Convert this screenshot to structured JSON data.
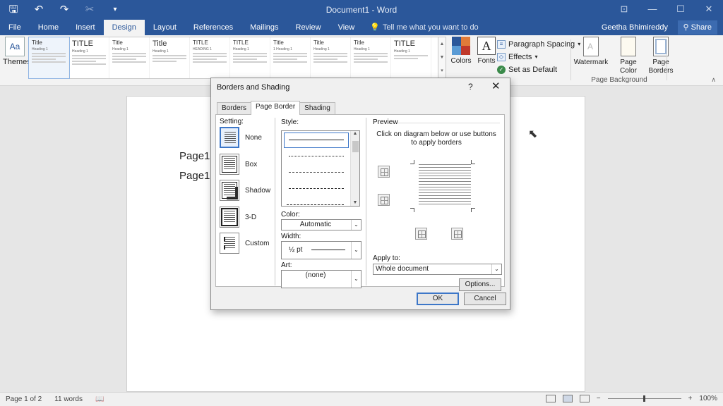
{
  "titlebar": {
    "title": "Document1 - Word",
    "qat": {
      "save": "🖫",
      "undo": "↶",
      "redo": "↷",
      "cut": "✂",
      "customize": "▾"
    },
    "window_buttons": {
      "ribbon_options": "⊡",
      "minimize": "—",
      "maximize": "☐",
      "close": "✕"
    }
  },
  "tabs": [
    "File",
    "Home",
    "Insert",
    "Design",
    "Layout",
    "References",
    "Mailings",
    "Review",
    "View"
  ],
  "active_tab": "Design",
  "tellme": {
    "icon": "💡",
    "text": "Tell me what you want to do"
  },
  "user": "Geetha Bhimireddy",
  "share": "Share",
  "ribbon": {
    "themes_label": "Themes",
    "themes_icon_text": "Aa",
    "gallery": [
      {
        "title": "Title",
        "heading": "Heading 1"
      },
      {
        "title": "TITLE",
        "heading": "Heading 1"
      },
      {
        "title": "Title",
        "heading": "Heading 1"
      },
      {
        "title": "Title",
        "heading": "Heading 1"
      },
      {
        "title": "TITLE",
        "heading": "HEADING 1"
      },
      {
        "title": "TITLE",
        "heading": "Heading 1"
      },
      {
        "title": "Title",
        "heading": "1 Heading 1"
      },
      {
        "title": "Title",
        "heading": "Heading 1"
      },
      {
        "title": "Title",
        "heading": "Heading 1"
      },
      {
        "title": "TITLE",
        "heading": "Heading 1"
      }
    ],
    "colors_label": "Colors",
    "fonts_label": "Fonts",
    "fonts_icon_text": "A",
    "paragraph_spacing": "Paragraph Spacing",
    "effects": "Effects",
    "set_as_default": "Set as Default",
    "watermark": "Watermark",
    "page_color": "Page Color",
    "page_borders": "Page Borders",
    "page_background_group": "Page Background",
    "theme_colors": [
      "#2b579a",
      "#e07b39",
      "#5a9bd5",
      "#c0392b"
    ]
  },
  "document": {
    "lines": [
      "Page1",
      "Page1"
    ]
  },
  "dialog": {
    "title": "Borders and Shading",
    "help": "?",
    "close": "✕",
    "tabs": [
      "Borders",
      "Page Border",
      "Shading"
    ],
    "active_tab": "Page Border",
    "setting_label": "Setting:",
    "settings": [
      "None",
      "Box",
      "Shadow",
      "3-D",
      "Custom"
    ],
    "selected_setting": "None",
    "style_label": "Style:",
    "color_label": "Color:",
    "color_value": "Automatic",
    "width_label": "Width:",
    "width_value": "½ pt",
    "art_label": "Art:",
    "art_value": "(none)",
    "preview_label": "Preview",
    "preview_hint": "Click on diagram below or use buttons to apply borders",
    "apply_to_label": "Apply to:",
    "apply_to_value": "Whole document",
    "options_button": "Options...",
    "ok_button": "OK",
    "cancel_button": "Cancel"
  },
  "statusbar": {
    "page": "Page 1 of 2",
    "words": "11 words",
    "zoom": "100%",
    "zoom_minus": "−",
    "zoom_plus": "+"
  }
}
